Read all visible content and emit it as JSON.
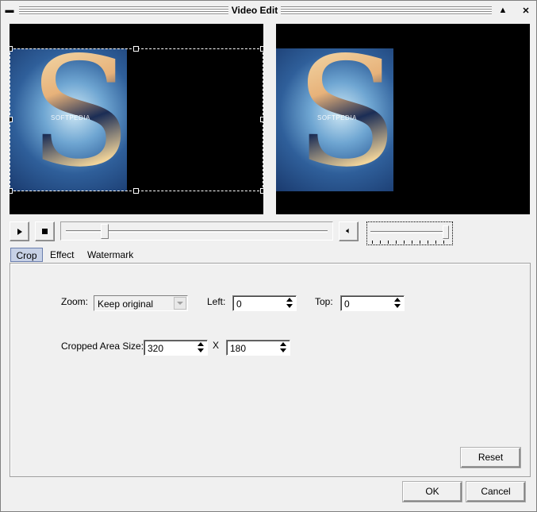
{
  "window": {
    "title": "Video Edit"
  },
  "preview": {
    "watermark_text": "SOFTPEDIA"
  },
  "tabs": [
    {
      "label": "Crop",
      "active": true
    },
    {
      "label": "Effect",
      "active": false
    },
    {
      "label": "Watermark",
      "active": false
    }
  ],
  "crop": {
    "zoom_label": "Zoom:",
    "zoom_value": "Keep original",
    "left_label": "Left:",
    "left_value": "0",
    "top_label": "Top:",
    "top_value": "0",
    "size_label": "Cropped Area Size:",
    "width_value": "320",
    "times_symbol": "X",
    "height_value": "180"
  },
  "buttons": {
    "reset": "Reset",
    "ok": "OK",
    "cancel": "Cancel"
  },
  "playback": {
    "seek_position_fraction": 0.15,
    "volume_fraction": 1.0
  },
  "colors": {
    "active_tab": "#c7d1e6",
    "video_background": "#000000"
  }
}
